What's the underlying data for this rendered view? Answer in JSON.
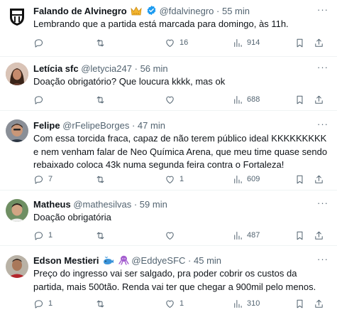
{
  "tweets": [
    {
      "name": "Falando de Alvinegro",
      "handle": "@fdalvinegro",
      "time": "55 min",
      "text": "Lembrando que a partida está marcada para domingo, às 11h.",
      "replies": "",
      "retweets": "",
      "likes": "16",
      "views": "914"
    },
    {
      "name": "Letícia sfc",
      "handle": "@letycia247",
      "time": "56 min",
      "text": "Doação obrigatório? Que loucura kkkk, mas ok",
      "replies": "",
      "retweets": "",
      "likes": "",
      "views": "688"
    },
    {
      "name": "Felipe",
      "handle": "@rFelipeBorges",
      "time": "47 min",
      "text": "Com essa torcida fraca, capaz de não terem público ideal KKKKKKKKK e nem venham falar de Neo Química Arena, que meu time quase sendo rebaixado coloca 43k numa segunda feira contra o Fortaleza!",
      "replies": "7",
      "retweets": "",
      "likes": "1",
      "views": "609"
    },
    {
      "name": "Matheus",
      "handle": "@mathesilvas",
      "time": "59 min",
      "text": "Doação obrigatória",
      "replies": "1",
      "retweets": "",
      "likes": "",
      "views": "487"
    },
    {
      "name": "Edson Mestieri",
      "handle": "@EddyeSFC",
      "time": "45 min",
      "text": "Preço do ingresso vai ser salgado, pra poder cobrir os custos da partida, mais 500tão. Renda vai ter que chegar a 900mil pelo menos.",
      "replies": "1",
      "retweets": "",
      "likes": "1",
      "views": "310"
    }
  ],
  "separator": "·",
  "colors": {
    "text": "#0f1419",
    "secondary": "#536471",
    "divider": "#eff3f4",
    "verified_gold": "#e8b923",
    "emoji_blue": "#3b94d9",
    "emoji_purple": "#a45ecf"
  },
  "icons": {
    "reply": "reply-icon",
    "retweet": "retweet-icon",
    "like": "heart-icon",
    "views": "views-chart-icon",
    "bookmark": "bookmark-icon",
    "share": "share-icon",
    "more": "more-options-icon"
  }
}
